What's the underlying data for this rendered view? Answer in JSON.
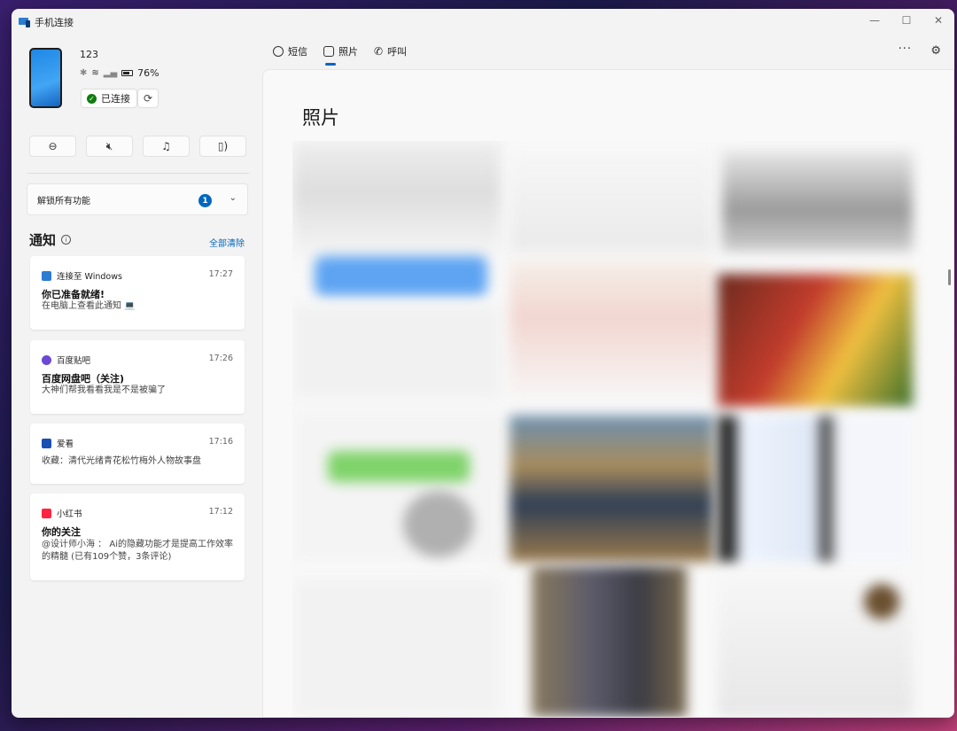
{
  "window": {
    "title": "手机连接",
    "controls": [
      "—",
      "☐",
      "✕"
    ]
  },
  "device": {
    "name": "123",
    "battery": "76%",
    "connection_status": "已连接"
  },
  "unlock": {
    "label": "解锁所有功能",
    "badge": "1"
  },
  "notifications": {
    "header": "通知",
    "clear_all": "全部清除",
    "items": [
      {
        "app": "连接至 Windows",
        "time": "17:27",
        "title": "你已准备就绪!",
        "body": "在电脑上查看此通知 💻",
        "color": "#2b7cd3"
      },
      {
        "app": "百度贴吧",
        "time": "17:26",
        "title": "百度网盘吧（关注)",
        "body": "大神们帮我看看我是不是被骗了",
        "color": "#6b49d6"
      },
      {
        "app": "爱看",
        "time": "17:16",
        "title": "",
        "body": "收藏：清代光绪青花松竹梅外人物故事盘",
        "color": "#1a4fb3"
      },
      {
        "app": "小红书",
        "time": "17:12",
        "title": "你的关注",
        "body": "@设计师小海 ： Ai的隐藏功能才是提高工作效率的精髓 (已有109个赞，3条评论)",
        "color": "#ff2442"
      }
    ]
  },
  "nav": {
    "tabs": [
      {
        "label": "短信",
        "icon": "message-icon"
      },
      {
        "label": "照片",
        "icon": "photo-icon"
      },
      {
        "label": "呼叫",
        "icon": "phone-icon"
      }
    ],
    "more": "···"
  },
  "photos": {
    "title": "照片"
  }
}
